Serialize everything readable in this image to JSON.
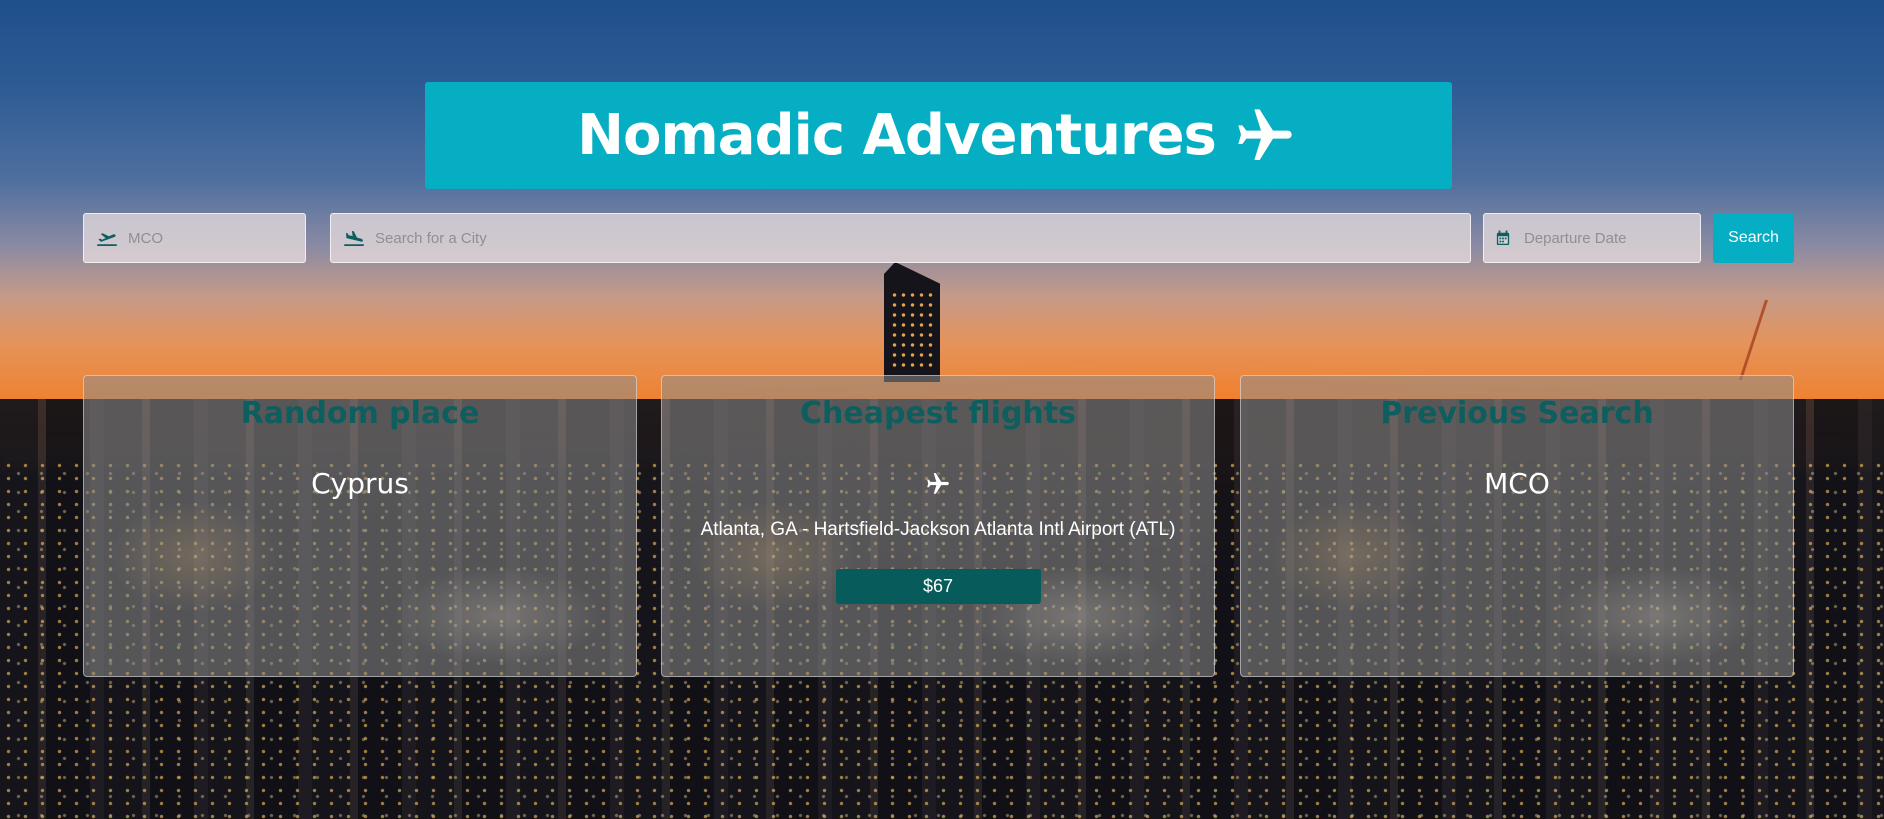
{
  "header": {
    "title": "Nomadic Adventures",
    "icon": "airplane-icon"
  },
  "search": {
    "origin": {
      "placeholder": "MCO",
      "icon": "plane-departure-icon"
    },
    "city": {
      "placeholder": "Search for a City",
      "icon": "plane-arrival-icon"
    },
    "date": {
      "placeholder": "Departure Date",
      "icon": "calendar-icon"
    },
    "button_label": "Search"
  },
  "cards": {
    "random": {
      "title": "Random place",
      "value": "Cyprus"
    },
    "cheapest": {
      "title": "Cheapest flights",
      "icon": "airplane-icon",
      "airport": "Atlanta, GA - Hartsfield-Jackson Atlanta Intl Airport (ATL)",
      "price": "$67"
    },
    "previous": {
      "title": "Previous Search",
      "value": "MCO"
    }
  },
  "colors": {
    "accent": "#06aec4",
    "card_title": "#0d5e5e",
    "price_badge": "#075b5b"
  }
}
